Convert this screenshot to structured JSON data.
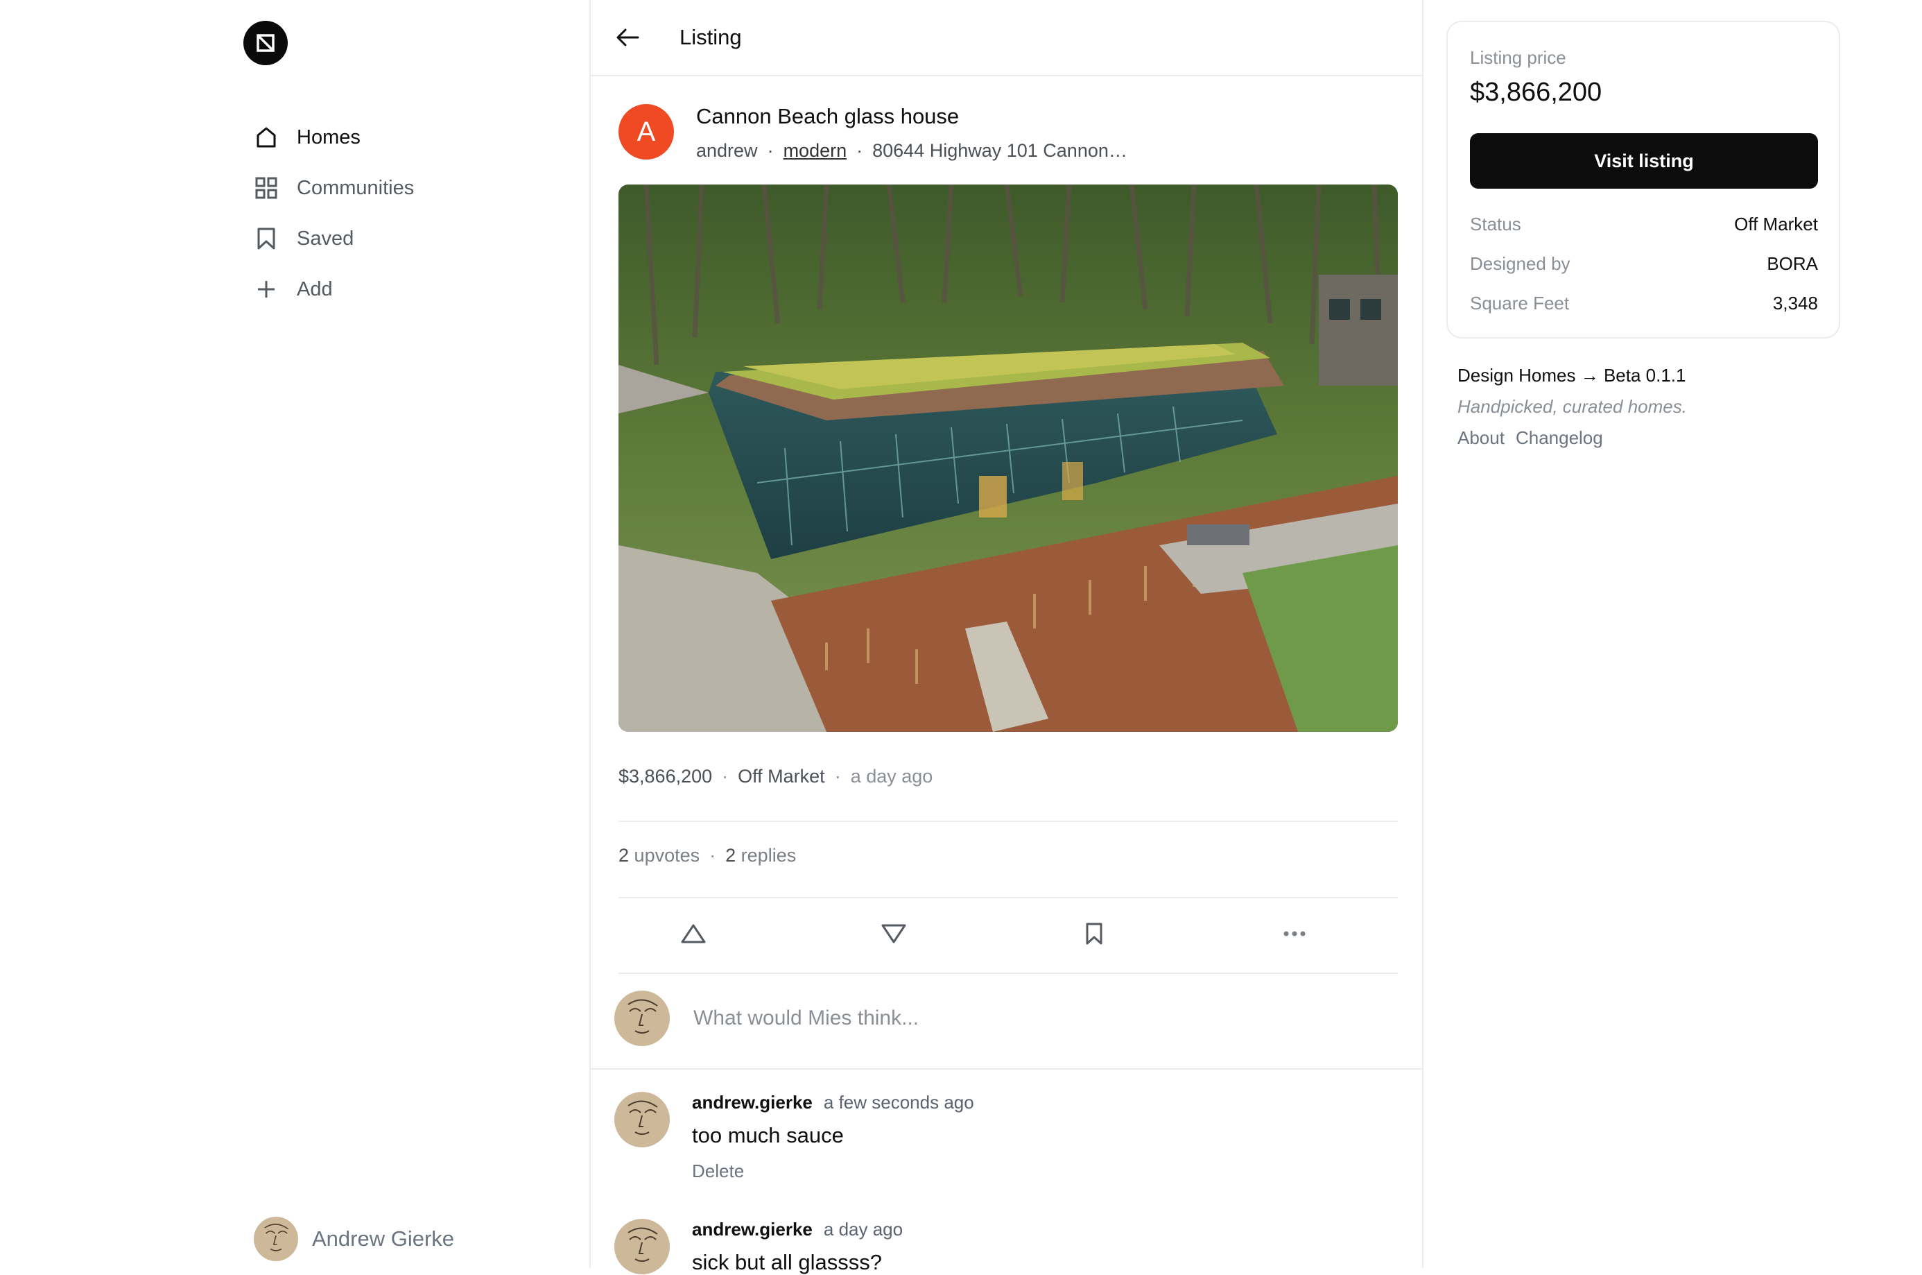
{
  "sidebar": {
    "logo_icon": "slashed-square-logo",
    "items": [
      {
        "label": "Homes",
        "icon": "home-icon",
        "active": true
      },
      {
        "label": "Communities",
        "icon": "grid-icon",
        "active": false
      },
      {
        "label": "Saved",
        "icon": "bookmark-icon",
        "active": false
      },
      {
        "label": "Add",
        "icon": "plus-icon",
        "active": false
      }
    ],
    "user_name": "Andrew Gierke"
  },
  "header": {
    "back_icon": "arrow-left-icon",
    "title": "Listing"
  },
  "post": {
    "avatar_letter": "A",
    "avatar_color": "#ef4a23",
    "title": "Cannon Beach glass house",
    "author": "andrew",
    "tag": "modern",
    "address": "80644 Highway 101 Cannon…",
    "price": "$3,866,200",
    "status": "Off Market",
    "time": "a day ago",
    "upvotes_count": "2",
    "upvotes_label": "upvotes",
    "replies_count": "2",
    "replies_label": "replies"
  },
  "actions": {
    "upvote_icon": "triangle-up-icon",
    "downvote_icon": "triangle-down-icon",
    "save_icon": "bookmark-icon",
    "more_icon": "ellipsis-icon"
  },
  "compose": {
    "placeholder": "What would Mies think..."
  },
  "comments": [
    {
      "user": "andrew.gierke",
      "time": "a few seconds ago",
      "text": "too much sauce",
      "delete_label": "Delete"
    },
    {
      "user": "andrew.gierke",
      "time": "a day ago",
      "text": "sick but all glassss?"
    }
  ],
  "listing_card": {
    "price_label": "Listing price",
    "price": "$3,866,200",
    "button_label": "Visit listing",
    "details": [
      {
        "key": "Status",
        "value": "Off Market"
      },
      {
        "key": "Designed by",
        "value": "BORA"
      },
      {
        "key": "Square Feet",
        "value": "3,348"
      }
    ]
  },
  "footer": {
    "brand": "Design Homes → Beta 0.1.1",
    "tagline": "Handpicked, curated homes.",
    "links": [
      "About",
      "Changelog"
    ]
  },
  "colors": {
    "accent_avatar": "#ef4a23",
    "button_bg": "#0c0c0c",
    "border": "#ececec"
  }
}
